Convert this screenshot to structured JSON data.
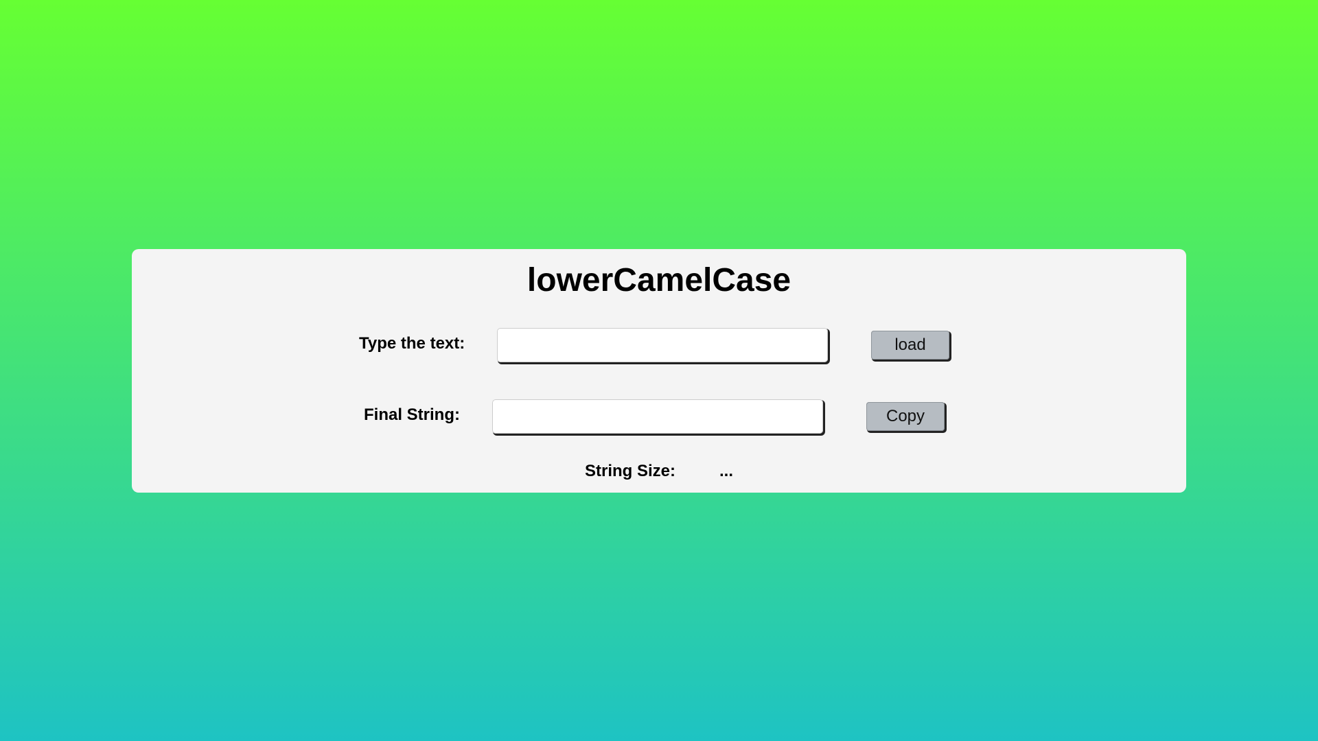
{
  "app": {
    "title": "lowerCamelCase"
  },
  "input_row": {
    "label": "Type the text:",
    "value": "",
    "button_label": "load"
  },
  "output_row": {
    "label": "Final String:",
    "value": "",
    "button_label": "Copy"
  },
  "size_row": {
    "label": "String Size:",
    "value": "..."
  },
  "colors": {
    "background_top": "#66ff33",
    "background_bottom": "#1ec3c3",
    "card": "#f4f4f4",
    "button": "#b6bcc2"
  }
}
